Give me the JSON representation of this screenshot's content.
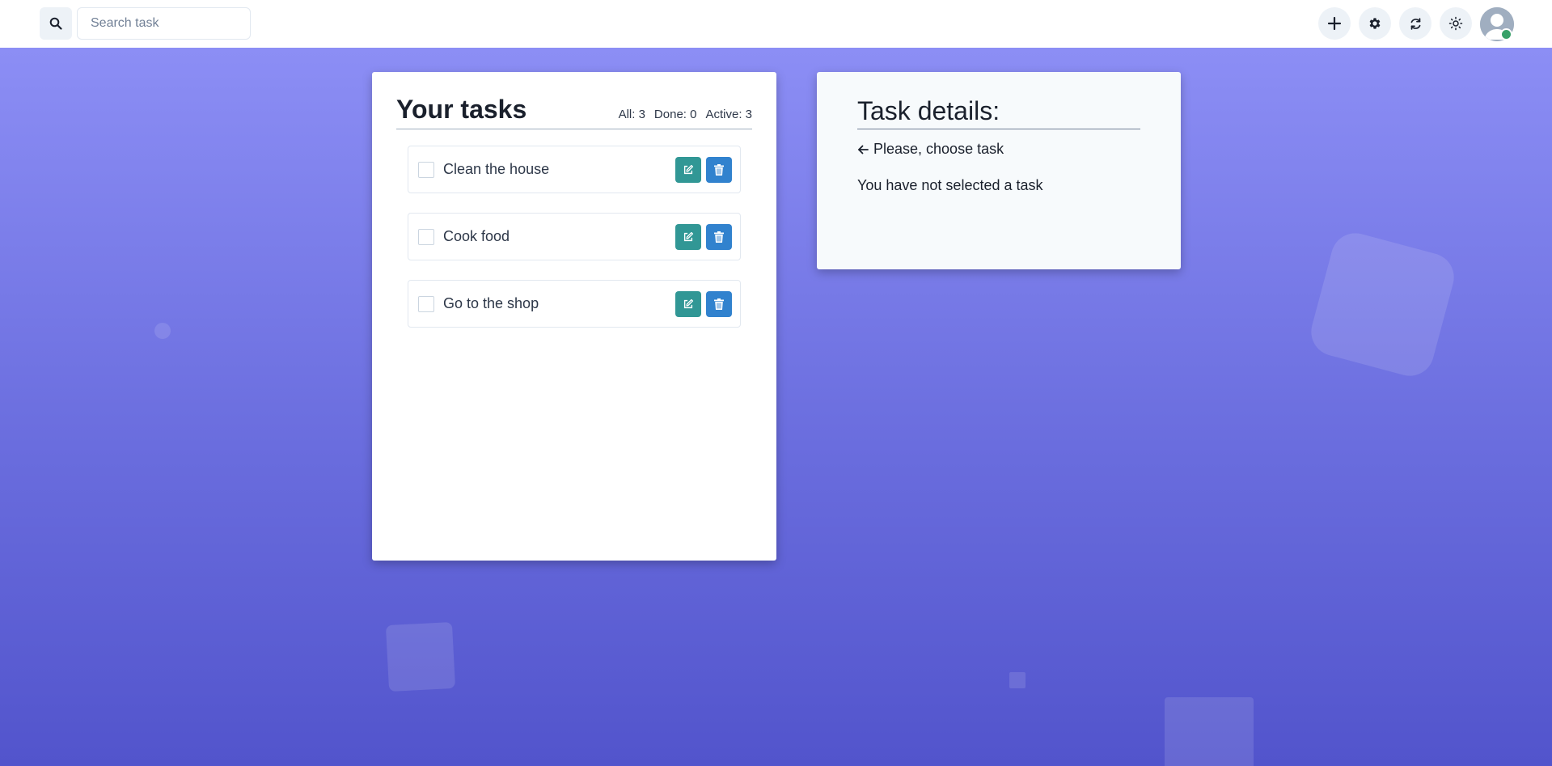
{
  "search": {
    "placeholder": "Search task"
  },
  "toolbar": {
    "add_icon": "plus-icon",
    "settings_icon": "gear-icon",
    "refresh_icon": "refresh-icon",
    "theme_icon": "sun-icon",
    "avatar_status_color": "#38a169"
  },
  "tasks_panel": {
    "title": "Your tasks",
    "counts": {
      "all": "All: 3",
      "done": "Done: 0",
      "active": "Active: 3"
    },
    "items": [
      {
        "label": "Clean the house",
        "done": false
      },
      {
        "label": "Cook food",
        "done": false
      },
      {
        "label": "Go to the shop",
        "done": false
      }
    ]
  },
  "details_panel": {
    "title": "Task details:",
    "hint": "Please, choose task",
    "message": "You have not selected a task"
  },
  "colors": {
    "edit_button": "#319795",
    "delete_button": "#3182ce",
    "background_top": "#8c8ef5",
    "background_bottom": "#5254cc"
  }
}
